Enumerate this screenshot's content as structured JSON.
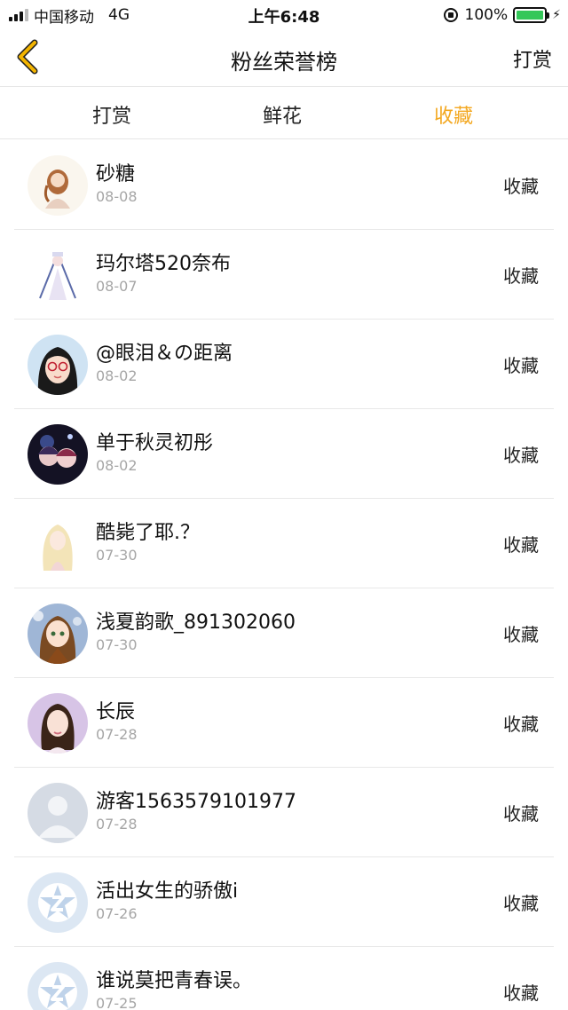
{
  "status_bar": {
    "carrier": "中国移动",
    "network": "4G",
    "time": "上午6:48",
    "battery": "100%",
    "battery_level": 1.0
  },
  "nav": {
    "back_icon": "chevron-left-icon",
    "title": "粉丝荣誉榜",
    "right_label": "打赏"
  },
  "tabs": [
    {
      "label": "打赏",
      "active": false
    },
    {
      "label": "鲜花",
      "active": false
    },
    {
      "label": "收藏",
      "active": true
    }
  ],
  "colors": {
    "accent": "#f3a821",
    "back_icon": "#f3b400"
  },
  "fans": [
    {
      "name": "砂糖",
      "date": "08-08",
      "action": "收藏",
      "avatar": "illustration-girl-avatar"
    },
    {
      "name": "玛尔塔520奈布",
      "date": "08-07",
      "action": "收藏",
      "avatar": "illustration-figure-avatar"
    },
    {
      "name": "@眼泪＆の距离",
      "date": "08-02",
      "action": "收藏",
      "avatar": "glasses-girl-avatar"
    },
    {
      "name": "单于秋灵初彤",
      "date": "08-02",
      "action": "收藏",
      "avatar": "dark-anime-avatar"
    },
    {
      "name": "酷毙了耶.？",
      "date": "07-30",
      "action": "收藏",
      "avatar": "blonde-girl-avatar"
    },
    {
      "name": "浅夏韵歌_891302060",
      "date": "07-30",
      "action": "收藏",
      "avatar": "anime-girl-avatar"
    },
    {
      "name": "长辰",
      "date": "07-28",
      "action": "收藏",
      "avatar": "girl-portrait-avatar"
    },
    {
      "name": "游客1563579101977",
      "date": "07-28",
      "action": "收藏",
      "avatar": "default-user-avatar"
    },
    {
      "name": "活出女生的骄傲i",
      "date": "07-26",
      "action": "收藏",
      "avatar": "default-z-avatar"
    },
    {
      "name": "谁说莫把青春误。",
      "date": "07-25",
      "action": "收藏",
      "avatar": "default-z-avatar"
    }
  ]
}
